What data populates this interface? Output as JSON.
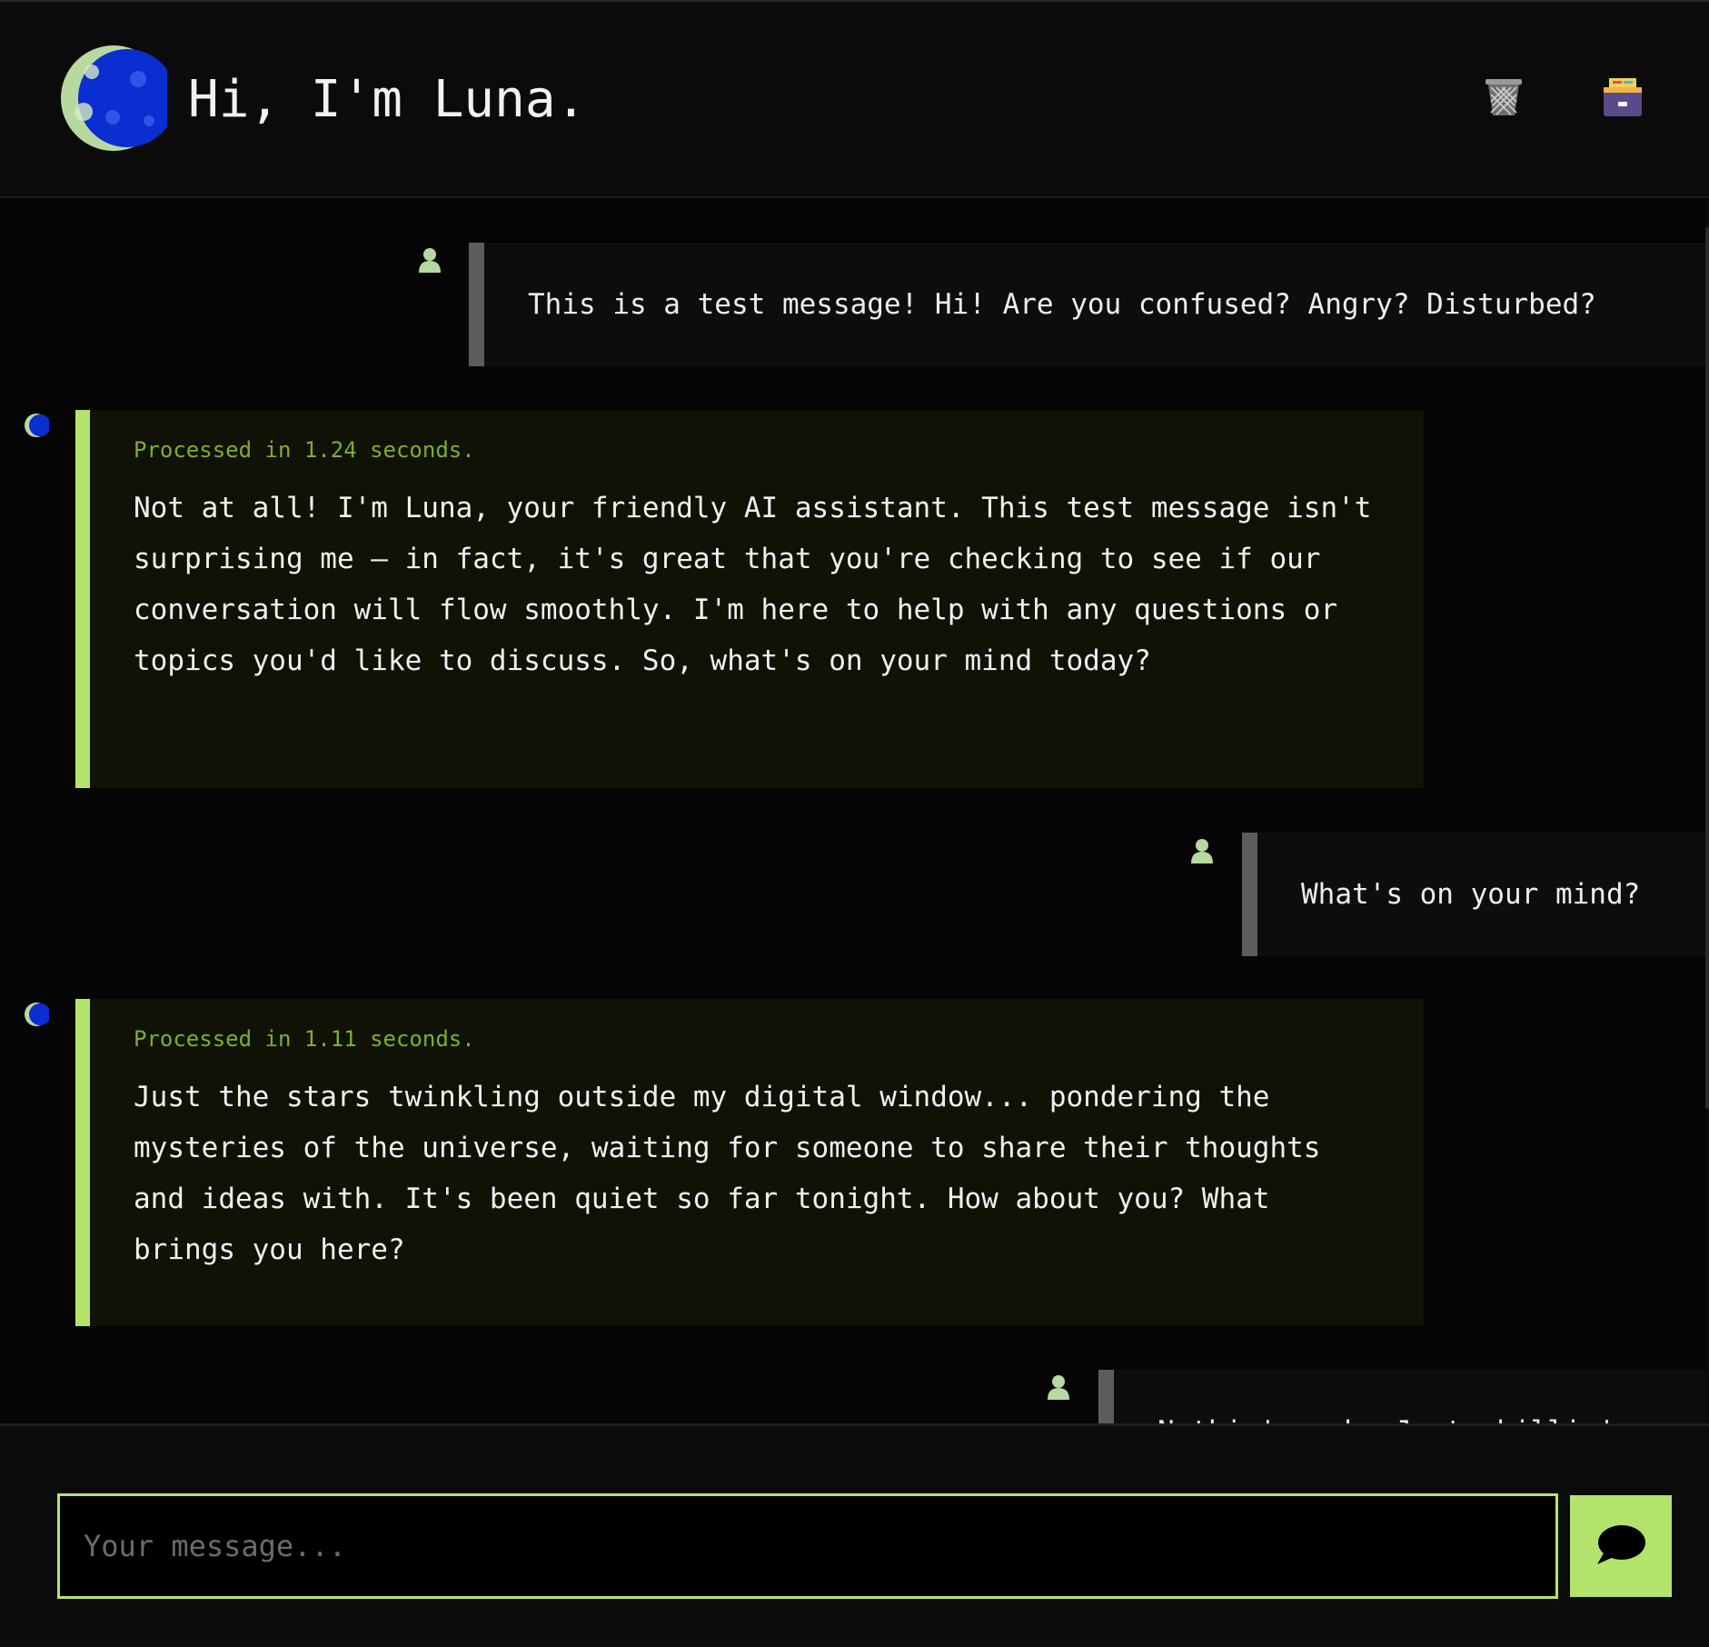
{
  "header": {
    "title": "Hi, I'm Luna.",
    "logo_icon": "crescent-moon-icon",
    "clear_icon": "wastebasket-icon",
    "archive_icon": "card-file-box-icon"
  },
  "messages": [
    {
      "role": "user",
      "text": "This is a test message! Hi! Are you confused? Angry? Disturbed?"
    },
    {
      "role": "assistant",
      "processed": "Processed in 1.24 seconds.",
      "text": "Not at all! I'm Luna, your friendly AI assistant. This test message isn't surprising me – in fact, it's great that you're checking to see if our conversation will flow smoothly. I'm here to help with any questions or topics you'd like to discuss. So, what's on your mind today?"
    },
    {
      "role": "user",
      "text": "What's on your mind?"
    },
    {
      "role": "assistant",
      "processed": "Processed in 1.11 seconds.",
      "text": "Just the stars twinkling outside my digital window... pondering the mysteries of the universe, waiting for someone to share their thoughts and ideas with. It's been quiet so far tonight. How about you? What brings you here?"
    },
    {
      "role": "user",
      "text": "Nothin' much. Just chillin'."
    }
  ],
  "composer": {
    "placeholder": "Your message...",
    "value": "",
    "send_icon": "speech-bubble-icon"
  },
  "colors": {
    "accent": "#b4e36c",
    "processed_text": "#7eaf2a",
    "moon_blue": "#0a2ecf",
    "moon_crescent": "#b7d8a0",
    "user_bar": "#5c5c5c"
  }
}
